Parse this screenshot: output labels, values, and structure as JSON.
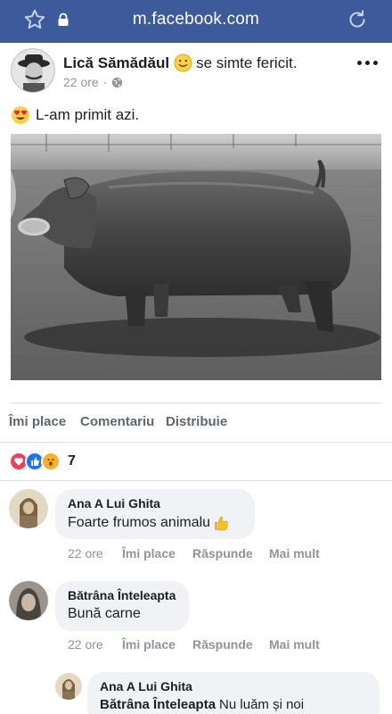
{
  "browser": {
    "url": "m.facebook.com",
    "icons": [
      "star-icon",
      "lock-icon",
      "reload-icon"
    ]
  },
  "post": {
    "author": "Lică Sămădăul",
    "feeling": "se simte fericit.",
    "feeling_emoji": "slightly-smiling-face",
    "time": "22 ore",
    "privacy_icon": "globe-icon",
    "text": "L-am primit azi.",
    "text_emoji": "heart-eyes-face",
    "image": "black-and-white photo of a pig standing on grass"
  },
  "actions": {
    "like": "Îmi place",
    "comment": "Comentariu",
    "share": "Distribuie"
  },
  "reactions": {
    "types": [
      "love",
      "like",
      "wow"
    ],
    "count": "7"
  },
  "comments": [
    {
      "name": "Ana A Lui Ghita",
      "text": "Foarte frumos animalu",
      "emoji": "thumbs-up",
      "time": "22 ore",
      "like": "Îmi place",
      "reply": "Răspunde",
      "more": "Mai mult"
    },
    {
      "name": "Bătrâna Înteleapta",
      "text": "Bună carne",
      "time": "22 ore",
      "like": "Îmi place",
      "reply": "Răspunde",
      "more": "Mai mult"
    }
  ],
  "reply": {
    "name": "Ana A Lui Ghita",
    "mention": "Bătrâna Înteleapta",
    "text": "Nu luăm și noi"
  },
  "colors": {
    "browser_bar": "#3d5a9a",
    "bubble": "#f0f2f5",
    "meta_gray": "#90949c",
    "action_gray": "#606770",
    "like_blue": "#1877f2",
    "love_red": "#f33e58",
    "wow_yellow": "#f7b125"
  }
}
